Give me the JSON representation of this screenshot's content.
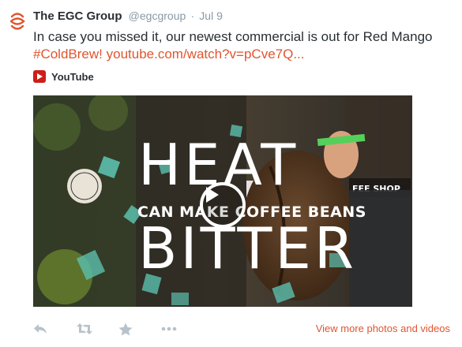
{
  "tweet": {
    "author_name": "The EGC Group",
    "handle": "@egcgroup",
    "separator": "·",
    "date": "Jul 9",
    "text_line1": "In case you missed it, our newest commercial is out for Red Mango",
    "hashtag": "#ColdBrew!",
    "link": "youtube.com/watch?v=pCve7Q...",
    "source": "YouTube"
  },
  "video": {
    "headline_top": "HEAT",
    "headline_middle": "CAN MAKE COFFEE BEANS",
    "headline_bottom": "BITTER",
    "background_sign": "COFFEE SHOP"
  },
  "actions": {
    "reply_icon": "reply-icon",
    "retweet_icon": "retweet-icon",
    "favorite_icon": "star-icon",
    "more_icon": "more-icon",
    "view_more": "View more photos and videos"
  },
  "colors": {
    "accent": "#e0552f",
    "youtube": "#cc1f1a",
    "muted": "#8899a6",
    "text": "#292f33"
  }
}
